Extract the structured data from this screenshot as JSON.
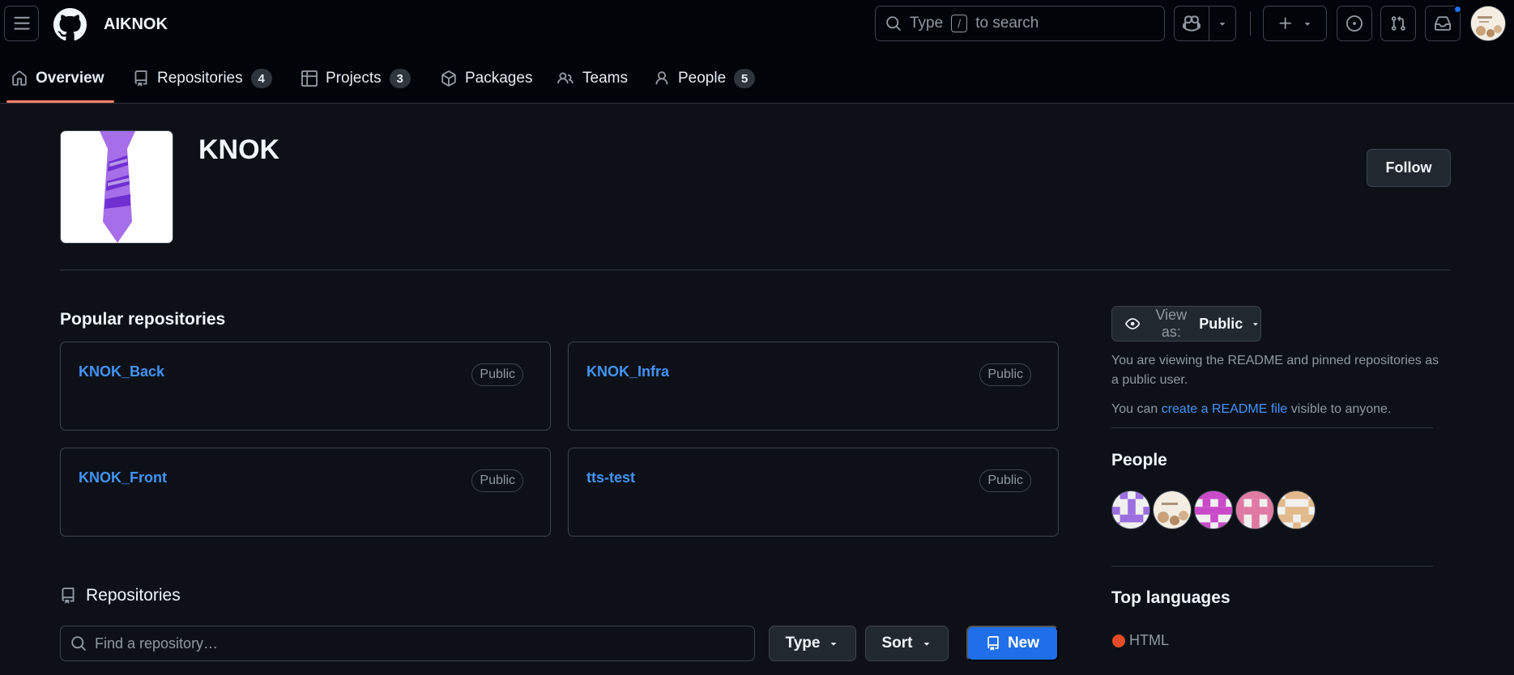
{
  "header": {
    "org_name": "AIKNOK",
    "search_prefix": "Type",
    "search_key": "/",
    "search_suffix": "to search"
  },
  "tabs": [
    {
      "label": "Overview",
      "icon": "home-icon",
      "selected": true
    },
    {
      "label": "Repositories",
      "icon": "repo-icon",
      "count": "4"
    },
    {
      "label": "Projects",
      "icon": "table-icon",
      "count": "3"
    },
    {
      "label": "Packages",
      "icon": "package-icon"
    },
    {
      "label": "Teams",
      "icon": "people-icon"
    },
    {
      "label": "People",
      "icon": "person-icon",
      "count": "5"
    }
  ],
  "profile": {
    "name": "KNOK",
    "follow_label": "Follow"
  },
  "popular": {
    "title": "Popular repositories",
    "repos": [
      {
        "name": "KNOK_Back",
        "visibility": "Public"
      },
      {
        "name": "KNOK_Infra",
        "visibility": "Public"
      },
      {
        "name": "KNOK_Front",
        "visibility": "Public"
      },
      {
        "name": "tts-test",
        "visibility": "Public"
      }
    ]
  },
  "repositories": {
    "title": "Repositories",
    "find_placeholder": "Find a repository…",
    "type_label": "Type",
    "sort_label": "Sort",
    "new_label": "New"
  },
  "sidebar": {
    "view_as_prefix": "View as:",
    "view_as_value": "Public",
    "viewing_text": "You are viewing the README and pinned repositories as a public user.",
    "readme_prefix": "You can",
    "readme_link": "create a README file",
    "readme_suffix": "visible to anyone.",
    "people_title": "People",
    "top_languages_title": "Top languages",
    "languages": [
      {
        "name": "HTML",
        "color": "#e34c26"
      }
    ]
  },
  "colors": {
    "accent_link": "#4493f8",
    "primary_button": "#1f6feb",
    "tab_underline": "#f78166",
    "background": "#0d1117"
  }
}
